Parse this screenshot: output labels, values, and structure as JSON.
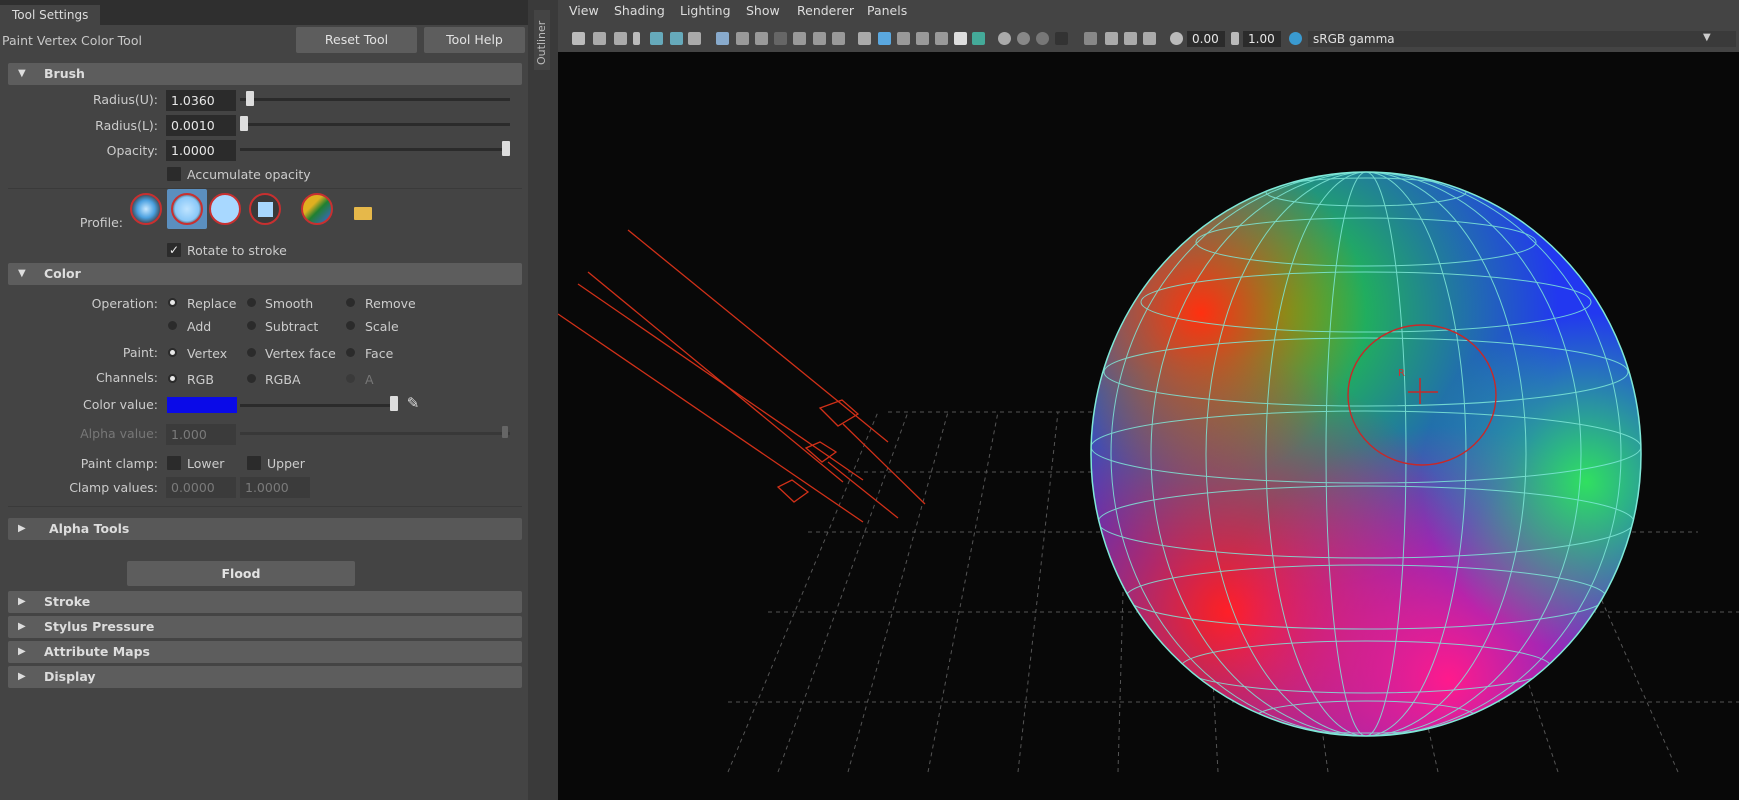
{
  "tabs": {
    "tool_settings": "Tool Settings"
  },
  "tool_name": "Paint Vertex Color Tool",
  "buttons": {
    "reset": "Reset Tool",
    "help": "Tool Help",
    "flood": "Flood"
  },
  "brush": {
    "title": "Brush",
    "radius_u_label": "Radius(U):",
    "radius_u": "1.0360",
    "radius_l_label": "Radius(L):",
    "radius_l": "0.0010",
    "opacity_label": "Opacity:",
    "opacity": "1.0000",
    "accumulate": "Accumulate opacity",
    "profile_label": "Profile:",
    "rotate": "Rotate to stroke"
  },
  "color": {
    "title": "Color",
    "operation_label": "Operation:",
    "ops": [
      "Replace",
      "Smooth",
      "Remove",
      "Add",
      "Subtract",
      "Scale"
    ],
    "paint_label": "Paint:",
    "paint": [
      "Vertex",
      "Vertex face",
      "Face"
    ],
    "channels_label": "Channels:",
    "channels": [
      "RGB",
      "RGBA",
      "A"
    ],
    "color_value_label": "Color value:",
    "color_value": "#0a0ae8",
    "alpha_label": "Alpha value:",
    "alpha": "1.000",
    "clamp_label": "Paint clamp:",
    "lower": "Lower",
    "upper": "Upper",
    "clamp_values_label": "Clamp values:",
    "clamp_low": "0.0000",
    "clamp_high": "1.0000"
  },
  "sections": {
    "alpha_tools": "Alpha Tools",
    "stroke": "Stroke",
    "stylus": "Stylus Pressure",
    "attr_maps": "Attribute Maps",
    "display": "Display"
  },
  "outliner": "Outliner",
  "viewport": {
    "menus": [
      "View",
      "Shading",
      "Lighting",
      "Show",
      "Renderer",
      "Panels"
    ],
    "field1": "0.00",
    "field2": "1.00",
    "colorspace": "sRGB gamma",
    "brush_marker": "R"
  }
}
